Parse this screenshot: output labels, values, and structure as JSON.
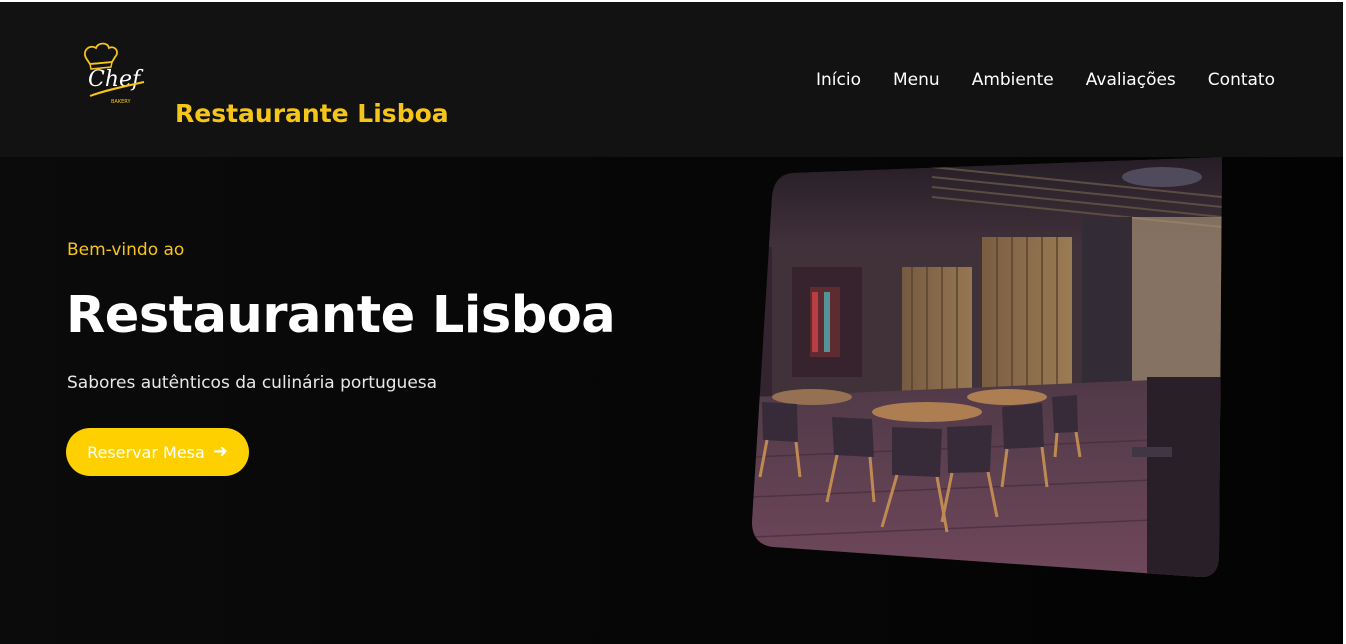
{
  "header": {
    "logo_text": "Chef",
    "logo_subtext": "BAKERY",
    "brand": "Restaurante Lisboa",
    "nav": [
      "Início",
      "Menu",
      "Ambiente",
      "Avaliações",
      "Contato"
    ]
  },
  "hero": {
    "eyebrow": "Bem-vindo ao",
    "title": "Restaurante Lisboa",
    "subtitle": "Sabores autênticos da culinária portuguesa",
    "cta_label": "Reservar Mesa",
    "cta_icon": "arrow-right-icon"
  },
  "colors": {
    "accent": "#f5c518",
    "button": "#ffd000",
    "header_bg": "#121212",
    "page_bg": "#050505"
  }
}
